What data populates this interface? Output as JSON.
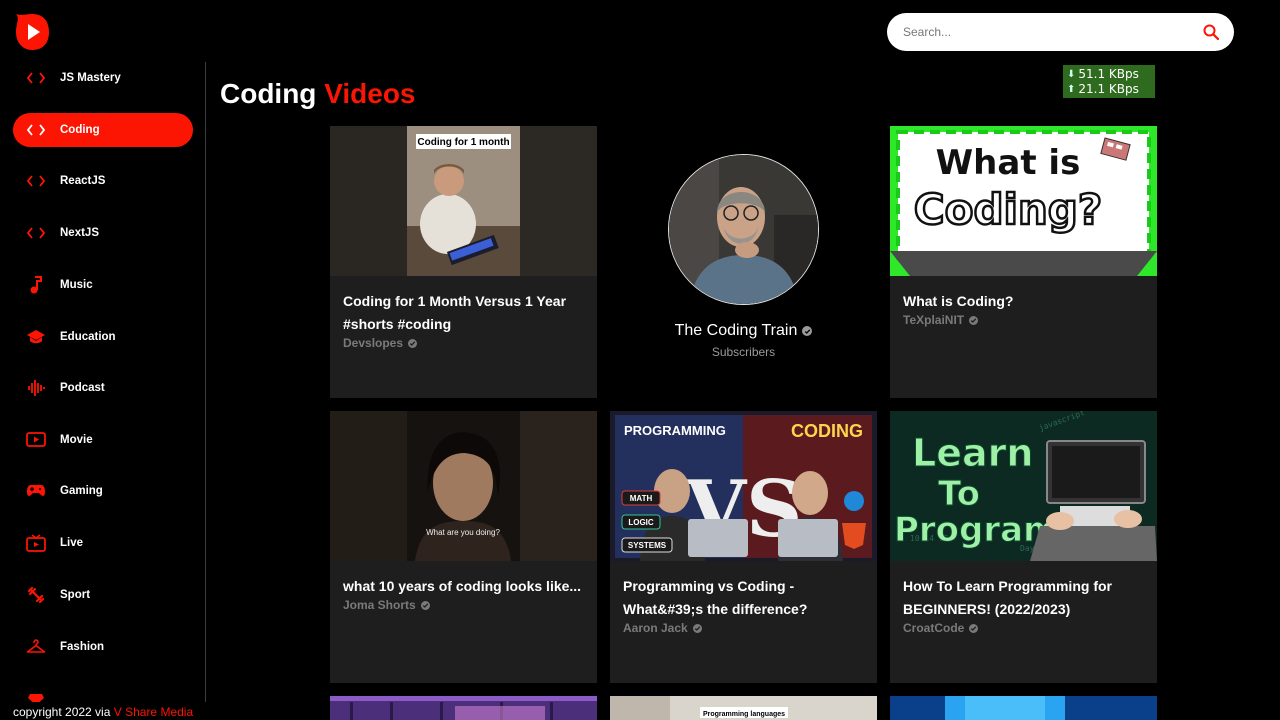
{
  "app": {
    "logo_icon": "play-logo-icon",
    "brand_color": "#fc1503"
  },
  "search": {
    "placeholder": "Search..."
  },
  "network_meter": {
    "down": "51.1 KBps",
    "up": "21.1 KBps"
  },
  "sidebar": {
    "items": [
      {
        "label": "JS Mastery",
        "icon": "code-icon"
      },
      {
        "label": "Coding",
        "icon": "code-icon",
        "active": true
      },
      {
        "label": "ReactJS",
        "icon": "code-icon"
      },
      {
        "label": "NextJS",
        "icon": "code-icon"
      },
      {
        "label": "Music",
        "icon": "music-note-icon"
      },
      {
        "label": "Education",
        "icon": "graduation-cap-icon"
      },
      {
        "label": "Podcast",
        "icon": "soundwave-icon"
      },
      {
        "label": "Movie",
        "icon": "movie-icon"
      },
      {
        "label": "Gaming",
        "icon": "gamepad-icon"
      },
      {
        "label": "Live",
        "icon": "live-tv-icon"
      },
      {
        "label": "Sport",
        "icon": "dumbbell-icon"
      },
      {
        "label": "Fashion",
        "icon": "hanger-icon"
      }
    ]
  },
  "footer": {
    "copyright_prefix": "copyright 2022 via",
    "brand": "V Share Media"
  },
  "main": {
    "heading_part1": "Coding",
    "heading_part2": "Videos",
    "channel": {
      "name": "The Coding Train",
      "subscribers_label": "Subscribers"
    },
    "videos": [
      {
        "title": "Coding for 1 Month Versus 1 Year #shorts #coding",
        "channel": "Devslopes",
        "thumb_caption": "Coding for 1 month"
      },
      {
        "title": "What is Coding?",
        "channel": "TeXplaiNIT",
        "thumb_caption": "What is Coding?"
      },
      {
        "title": "what 10 years of coding looks like...",
        "channel": "Joma Shorts",
        "thumb_caption": "What are you doing?"
      },
      {
        "title": "Programming vs Coding - What&#39;s the difference?",
        "channel": "Aaron Jack",
        "thumb_left": "PROGRAMMING",
        "thumb_right": "CODING",
        "thumb_tags": [
          "MATH",
          "LOGIC",
          "SYSTEMS"
        ]
      },
      {
        "title": "How To Learn Programming for BEGINNERS! (2022/2023)",
        "channel": "CroatCode",
        "thumb_caption": "Learn To Program",
        "thumb_code": "javascript"
      },
      {
        "thumb_caption": "Programming languages"
      }
    ]
  }
}
